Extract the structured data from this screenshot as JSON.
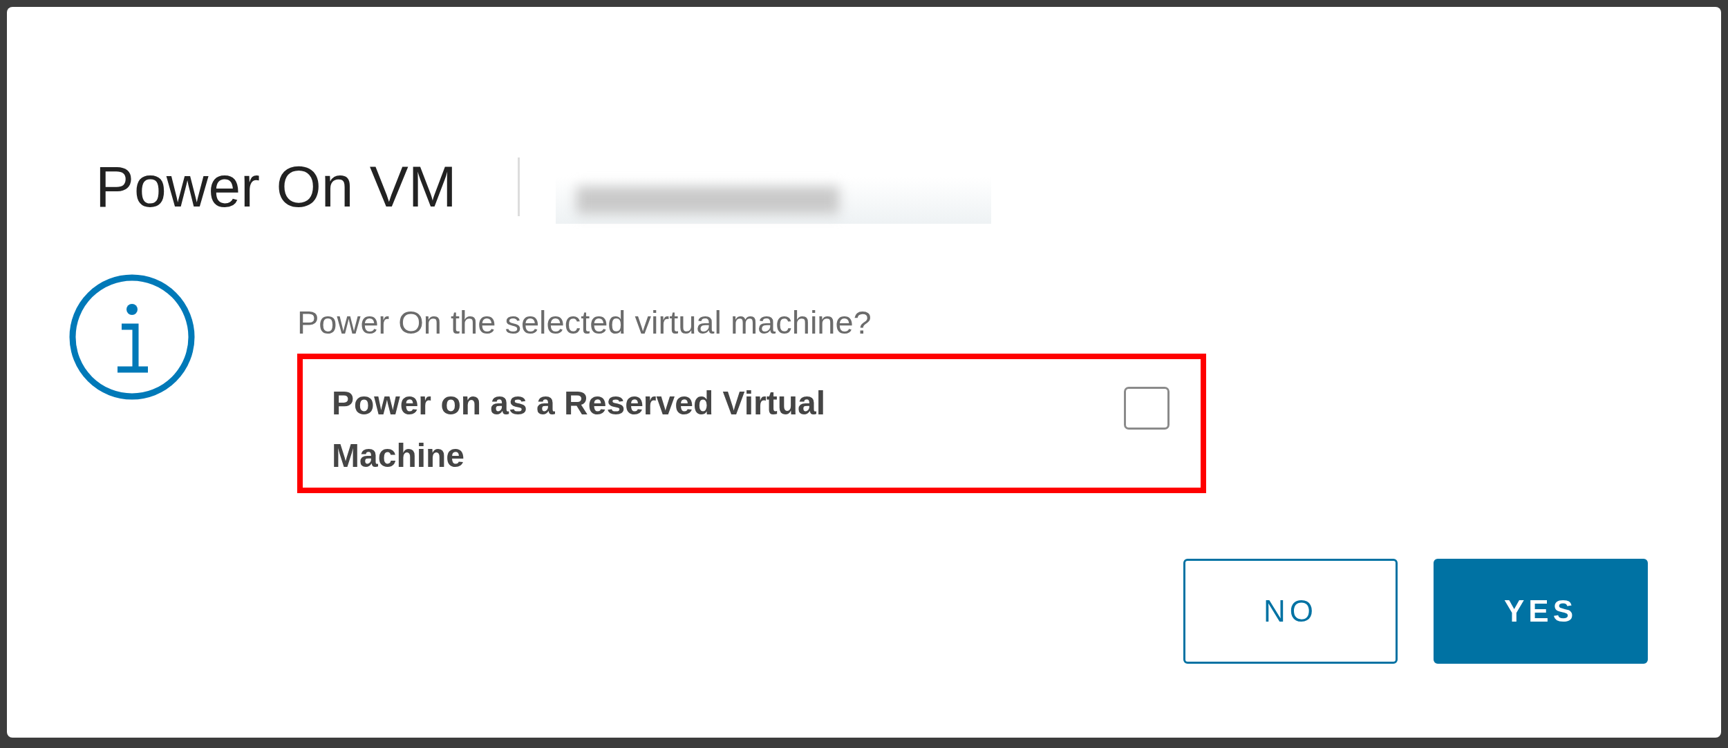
{
  "dialog": {
    "title": "Power On VM",
    "message": "Power On the selected virtual machine?",
    "option": {
      "label": "Power on as a Reserved Virtual Machine",
      "checked": false,
      "highlighted": true
    },
    "buttons": [
      {
        "label": "NO",
        "kind": "secondary"
      },
      {
        "label": "YES",
        "kind": "primary"
      }
    ]
  }
}
